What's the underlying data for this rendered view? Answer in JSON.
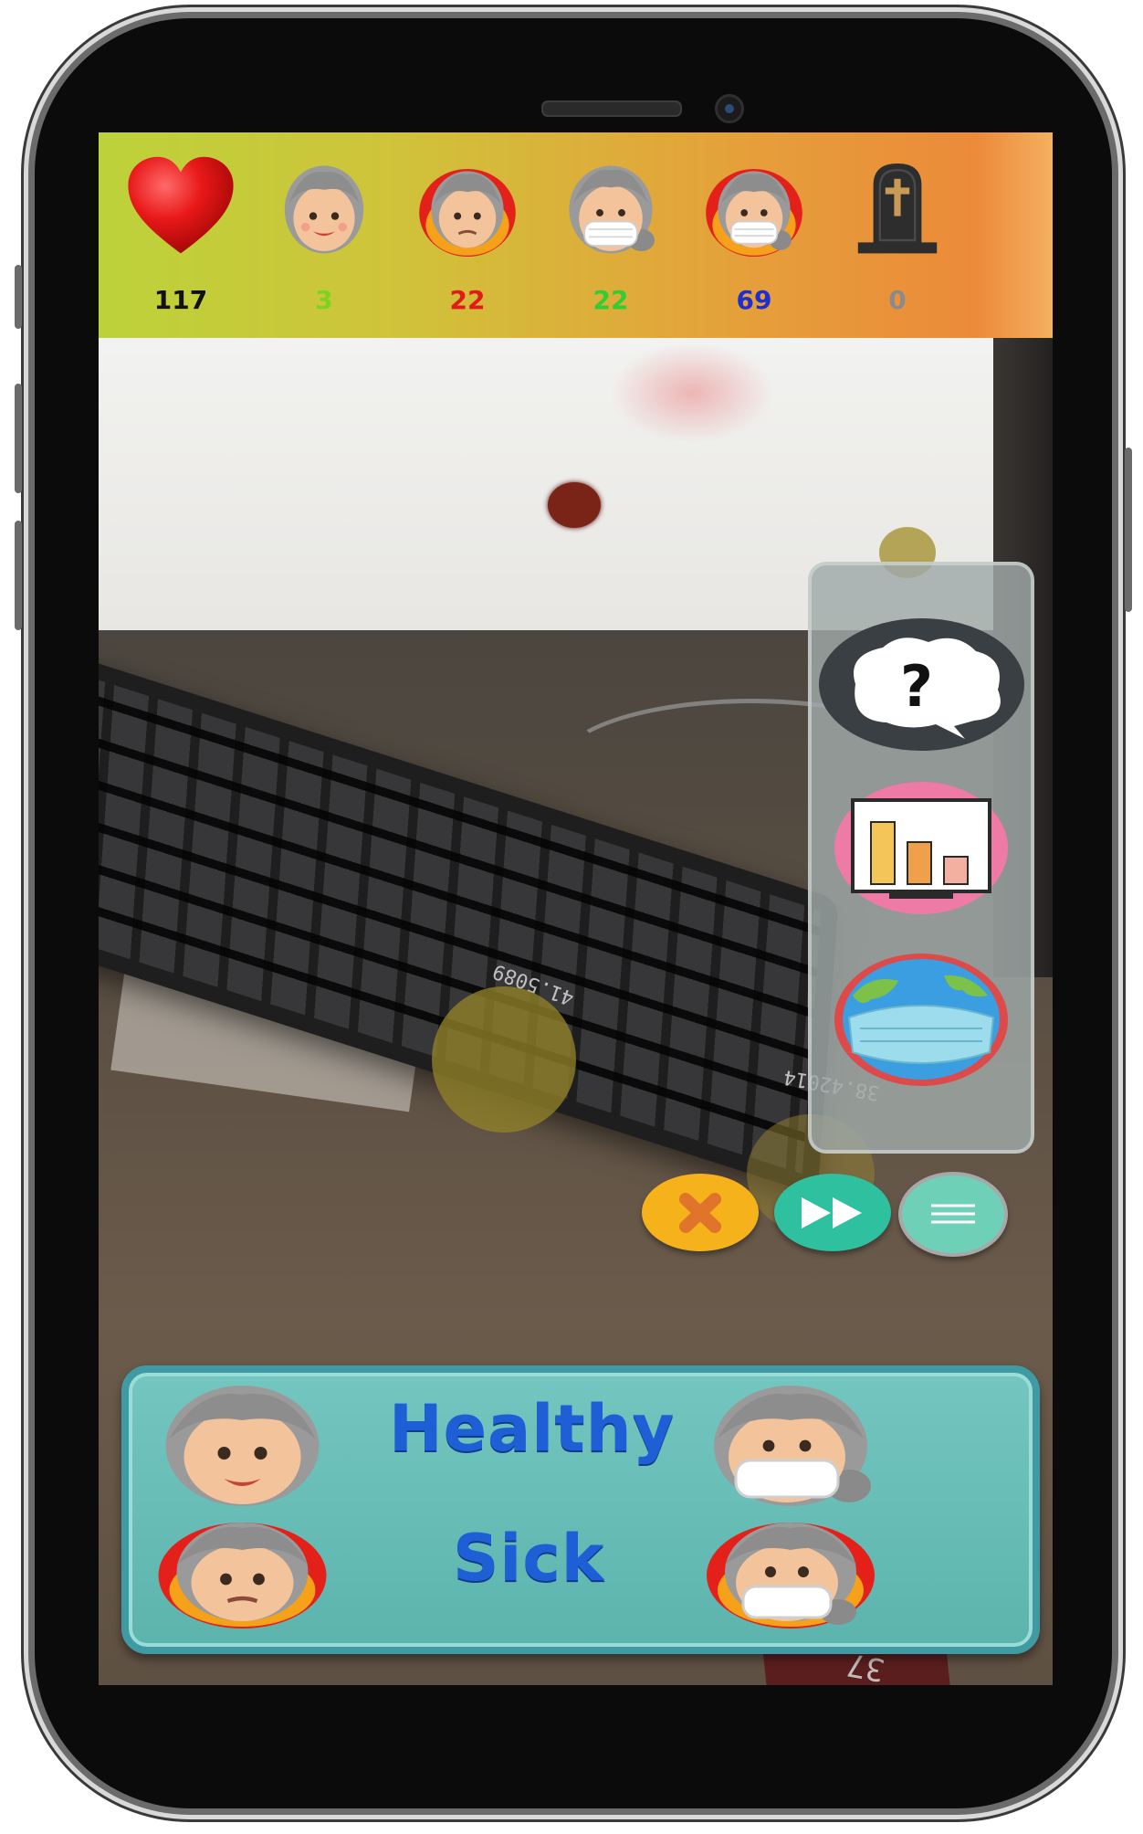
{
  "stats": {
    "total": {
      "icon": "heart-icon",
      "value": "117",
      "color": "#111111"
    },
    "healthy": {
      "icon": "healthy-face-icon",
      "value": "3",
      "color": "#7ed321"
    },
    "sick": {
      "icon": "sick-face-icon",
      "value": "22",
      "color": "#e11b1b"
    },
    "healthy_masked": {
      "icon": "healthy-masked-face-icon",
      "value": "22",
      "color": "#33cc33"
    },
    "sick_masked": {
      "icon": "sick-masked-face-icon",
      "value": "69",
      "color": "#1f2fcf"
    },
    "deaths": {
      "icon": "tombstone-icon",
      "value": "0",
      "color": "#8a8a8a"
    }
  },
  "side_menu": {
    "help": {
      "icon": "question-bubble-icon",
      "glyph": "?"
    },
    "statistics": {
      "icon": "bar-chart-icon"
    },
    "world_mask": {
      "icon": "earth-mask-icon"
    }
  },
  "controls": {
    "stop": {
      "icon": "close-icon",
      "color": "#f6b21a"
    },
    "fast_forward": {
      "icon": "fast-forward-icon",
      "color": "#2fc0a0"
    },
    "menu": {
      "icon": "hamburger-menu-icon",
      "color": "#6fd0b8"
    }
  },
  "scene_labels": {
    "label_a": "41.5089",
    "label_b": "38.42014",
    "label_c": "37"
  },
  "legend": {
    "healthy_label": "Healthy",
    "sick_label": "Sick"
  }
}
